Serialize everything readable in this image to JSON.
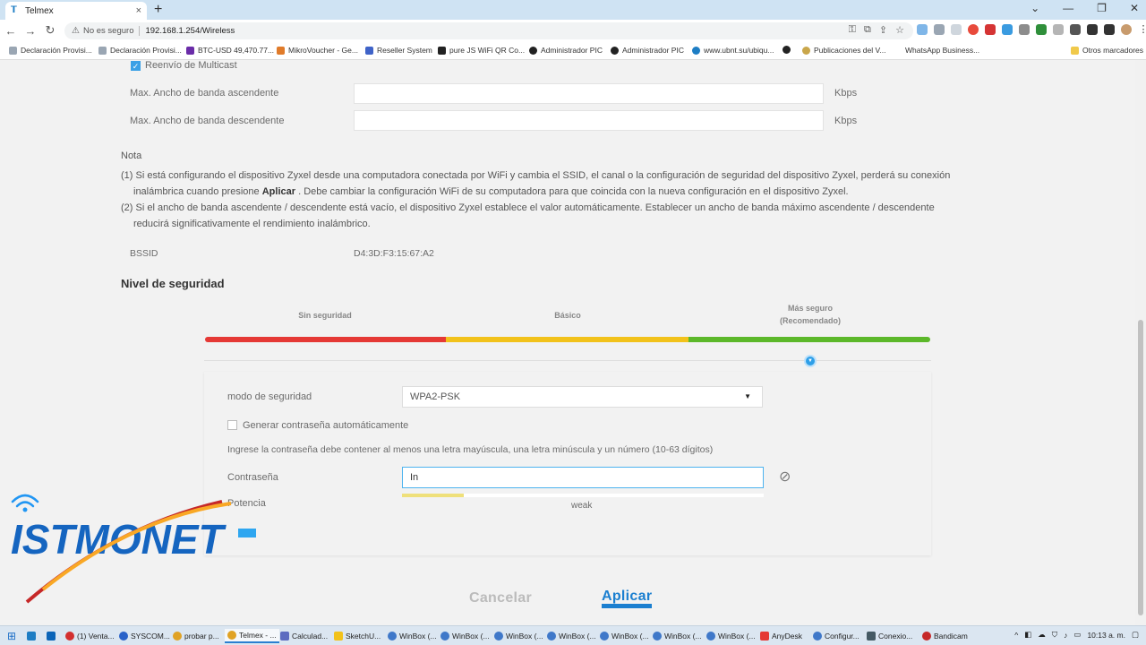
{
  "browser": {
    "tab_title": "Telmex",
    "tab_close": "×",
    "new_tab": "+",
    "window_controls": [
      "⌄",
      "—",
      "❐",
      "✕"
    ],
    "nav": [
      "←",
      "→",
      "↻"
    ],
    "security_label": "No es seguro",
    "url": "192.168.1.254/Wireless",
    "bookmarks": [
      "Declaración Provisi...",
      "Declaración Provisi...",
      "BTC-USD 49,470.77...",
      "MikroVoucher - Ge...",
      "Reseller System",
      "pure JS WiFi QR Co...",
      "Administrador PIC",
      "Administrador PIC",
      "www.ubnt.su/ubiqu...",
      "",
      "Publicaciones del V...",
      "WhatsApp Business..."
    ],
    "other_bookmarks": "Otros marcadores"
  },
  "form": {
    "multicast_label": "Reenvío de Multicast",
    "max_up_label": "Max. Ancho de banda ascendente",
    "max_down_label": "Max. Ancho de banda descendente",
    "unit": "Kbps",
    "note_title": "Nota",
    "note1_a": "(1) Si está configurando el dispositivo Zyxel desde una computadora conectada por WiFi y cambia el SSID, el canal o la configuración de seguridad del dispositivo Zyxel, perderá su conexión",
    "note1_b": "inalámbrica cuando presione",
    "note1_bold": "Aplicar",
    "note1_c": ". Debe cambiar la configuración WiFi de su computadora para que coincida con la nueva configuración en el dispositivo Zyxel.",
    "note2_a": "(2) Si el ancho de banda ascendente / descendente está vacío, el dispositivo Zyxel establece el valor automáticamente. Establecer un ancho de banda máximo ascendente / descendente",
    "note2_b": "reducirá significativamente el rendimiento inalámbrico.",
    "bssid_label": "BSSID",
    "bssid_value": "D4:3D:F3:15:67:A2"
  },
  "security": {
    "title": "Nivel de seguridad",
    "level_none": "Sin seguridad",
    "level_basic": "Básico",
    "level_best_1": "Más seguro",
    "level_best_2": "(Recomendado)",
    "colors": {
      "none": "#e53935",
      "basic": "#f2c21b",
      "best": "#5cb82a"
    },
    "mode_label": "modo de seguridad",
    "mode_value": "WPA2-PSK",
    "auto_pwd_label": "Generar contraseña automáticamente",
    "hint": "Ingrese la contraseña debe contener al menos una letra mayúscula, una letra minúscula y un número (10-63 dígitos)",
    "password_label": "Contraseña",
    "password_value": "In",
    "strength_label": "weak",
    "strength_fraction": 0.17,
    "power_label": "Potencia"
  },
  "actions": {
    "cancel": "Cancelar",
    "apply": "Aplicar"
  },
  "watermark": {
    "brand": "ISTMONET"
  },
  "taskbar": {
    "items": [
      "(1) Venta...",
      "SYSCOM...",
      "probar p...",
      "Telmex - ...",
      "Calculad...",
      "SketchU...",
      "WinBox (...",
      "WinBox (...",
      "WinBox (...",
      "WinBox (...",
      "WinBox (...",
      "WinBox (...",
      "WinBox (...",
      "AnyDesk",
      "Configur...",
      "Conexio...",
      "Bandicam"
    ],
    "clock": "10:13 a. m."
  }
}
